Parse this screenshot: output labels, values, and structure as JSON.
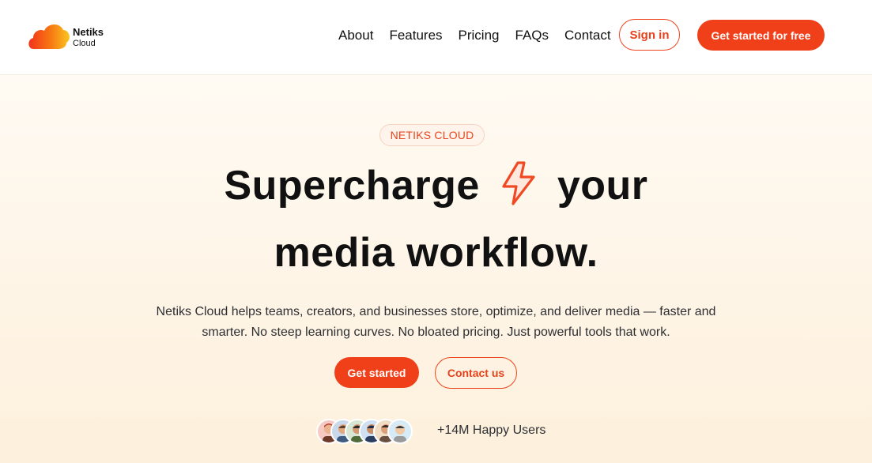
{
  "brand": {
    "name": "Netiks",
    "sub": "Cloud"
  },
  "nav": {
    "items": [
      {
        "label": "About"
      },
      {
        "label": "Features"
      },
      {
        "label": "Pricing"
      },
      {
        "label": "FAQs"
      },
      {
        "label": "Contact"
      }
    ],
    "sign_in": "Sign in",
    "cta": "Get started for free"
  },
  "hero": {
    "badge": "NETIKS CLOUD",
    "title_part1": "Supercharge",
    "title_icon": "lightning-bolt-icon",
    "title_part2": "your",
    "title_line2": "media workflow.",
    "lead": "Netiks Cloud helps teams, creators, and businesses store, optimize, and deliver media — faster and smarter. No steep learning curves. No bloated pricing. Just powerful tools that work.",
    "primary_button": "Get started",
    "secondary_button": "Contact us",
    "social_proof": "+14M Happy Users"
  },
  "colors": {
    "accent": "#f0401a",
    "hero_bg_top": "#fffaf3",
    "hero_bg_bottom": "#fdf0dc"
  }
}
